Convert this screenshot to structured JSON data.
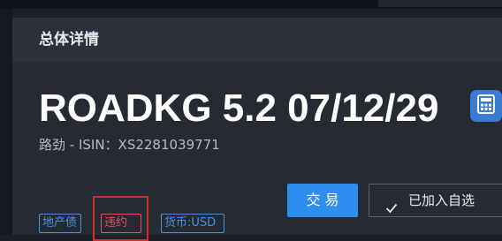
{
  "panel": {
    "title": "总体详情"
  },
  "bond": {
    "title": "ROADKG 5.2 07/12/29",
    "subtitle": "路劲 - ISIN：XS2281039771"
  },
  "tags": {
    "sector": "地产债",
    "default": "违约",
    "currency": "货币:USD"
  },
  "actions": {
    "trade_label": "交 易",
    "watchlist_label": "已加入自选"
  },
  "icons": {
    "calculator": "calculator-icon",
    "check": "check-icon"
  },
  "colors": {
    "accent": "#2e8ef0",
    "tag_blue": "#4a90e2",
    "tag_red": "#e05555",
    "highlight": "#d62b2b"
  }
}
